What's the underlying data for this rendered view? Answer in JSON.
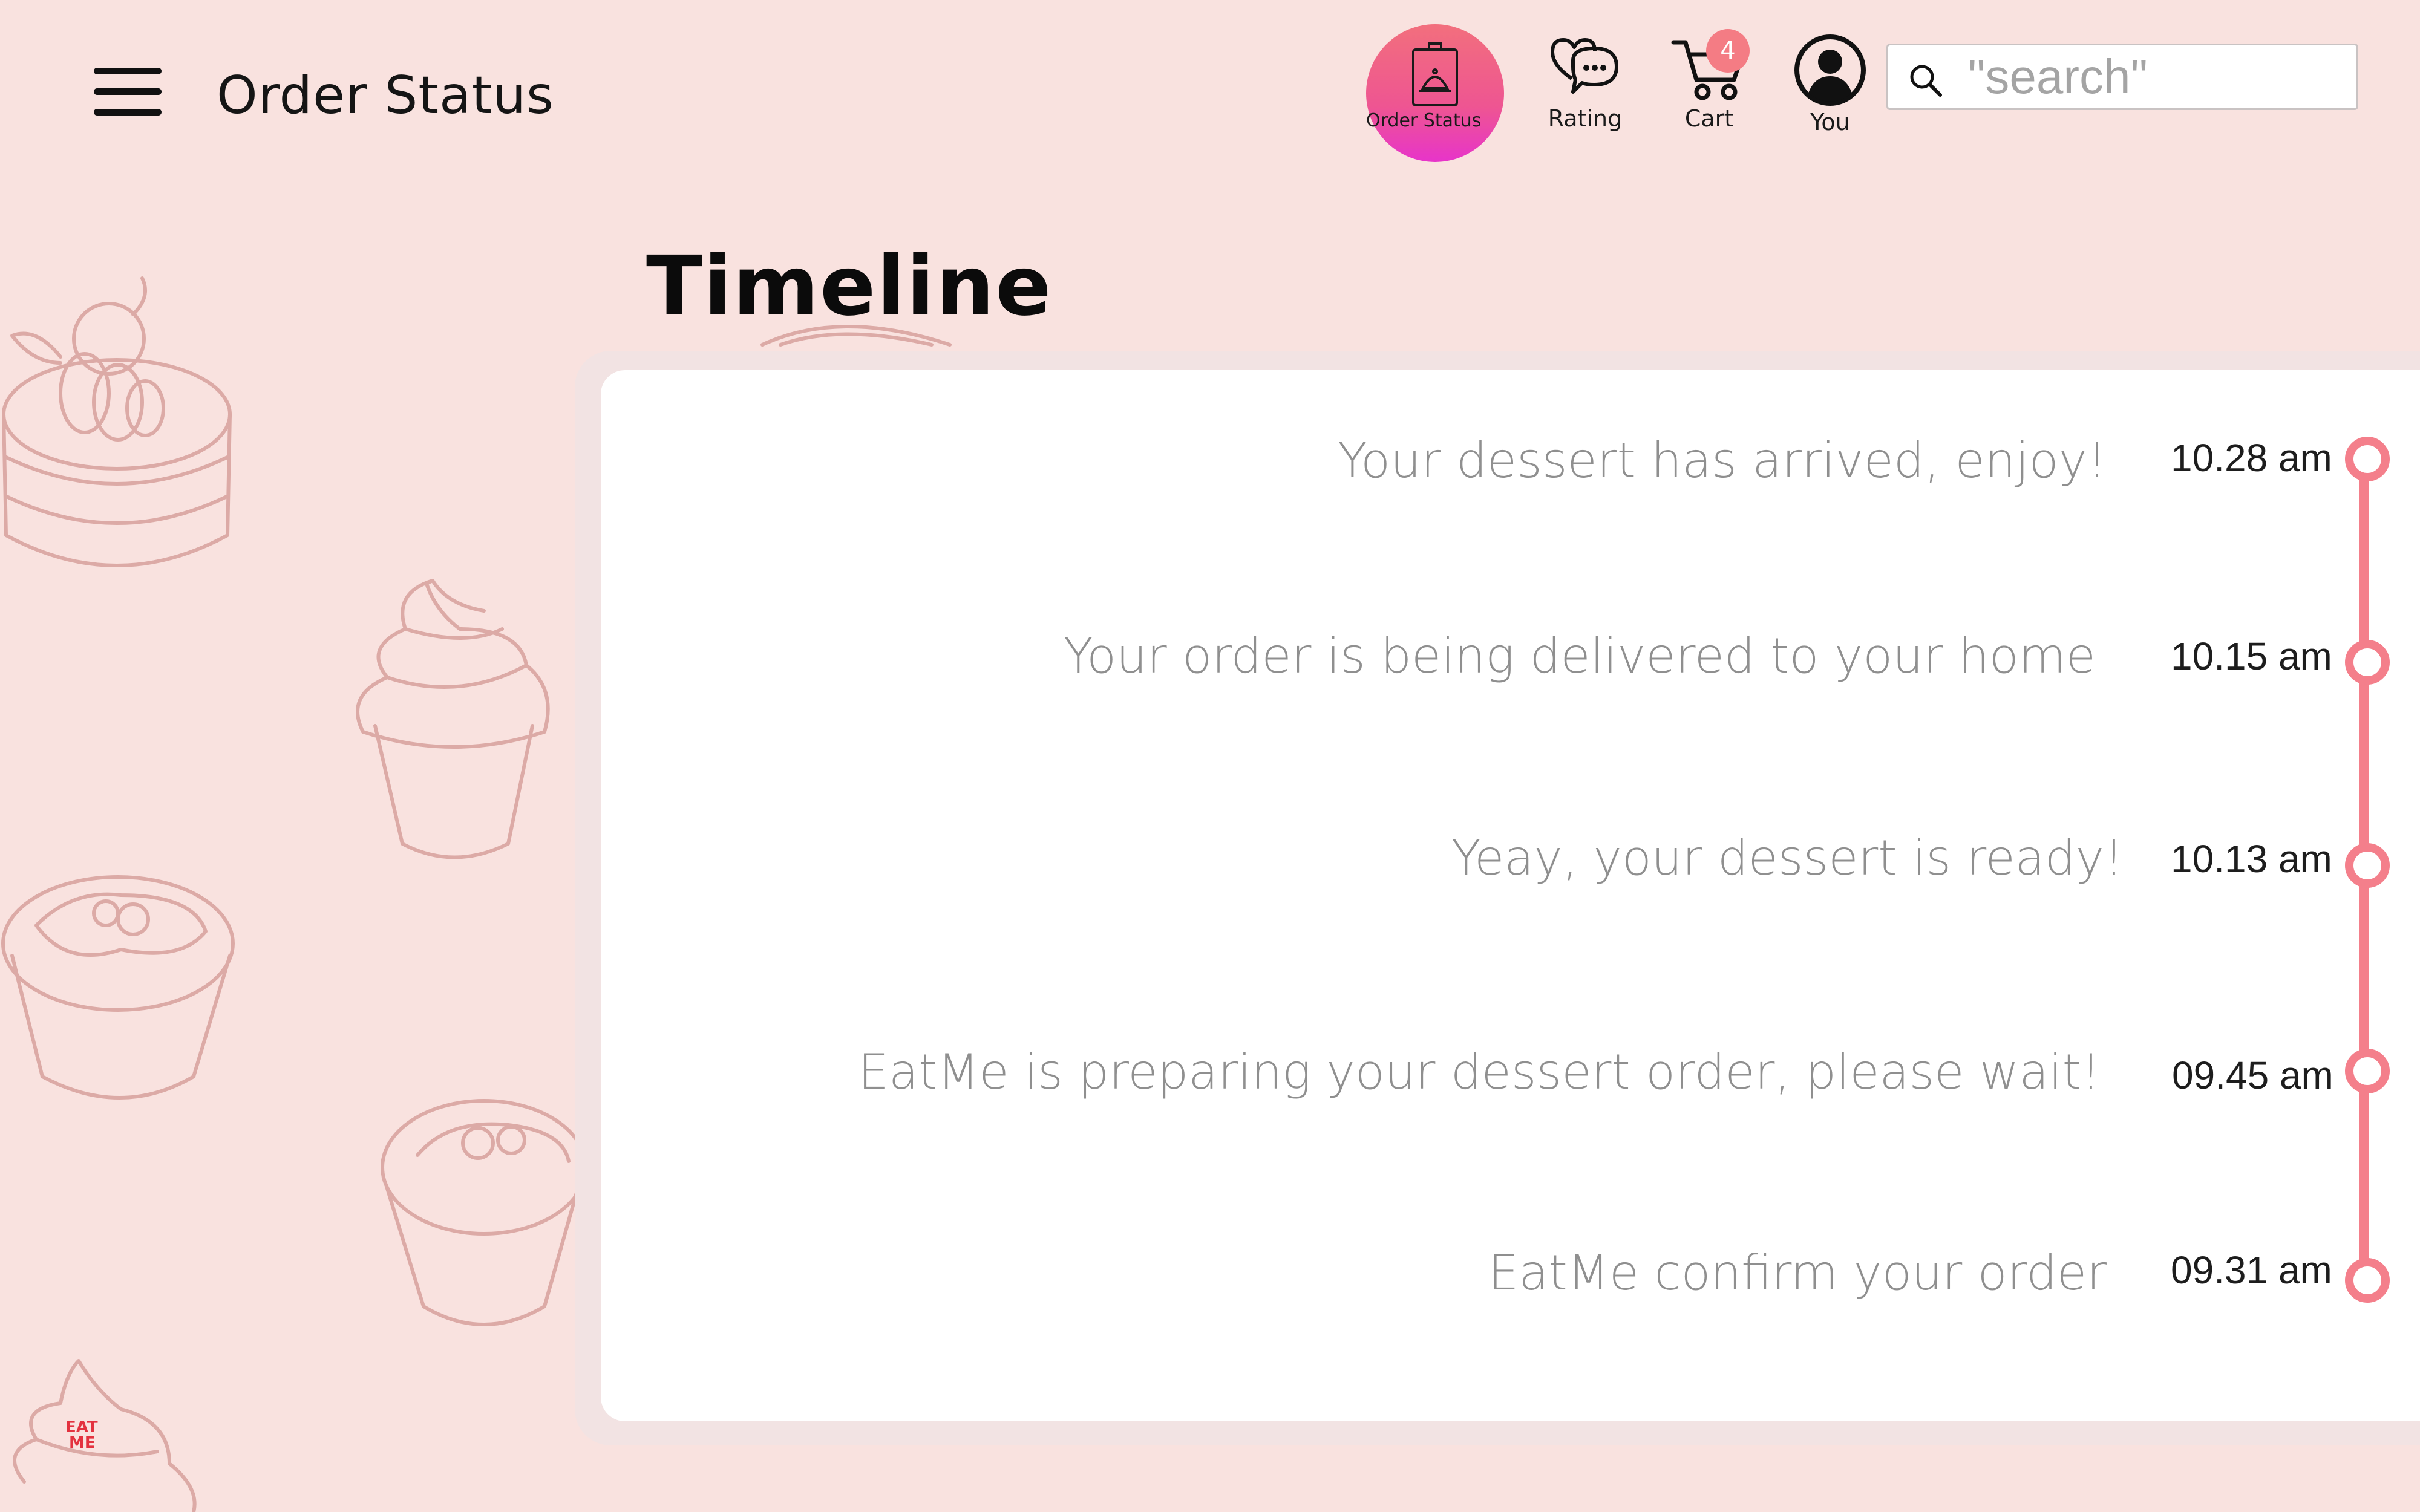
{
  "header": {
    "title": "Order Status",
    "menu_icon": "hamburger-menu-icon",
    "nav": [
      {
        "label": "Order Status",
        "icon": "food-bag-icon",
        "active": true
      },
      {
        "label": "Rating",
        "icon": "heart-chat-icon"
      },
      {
        "label": "Cart",
        "icon": "cart-icon",
        "badge": "4"
      },
      {
        "label": "You",
        "icon": "user-circle-icon"
      }
    ],
    "search": {
      "placeholder": "\"search\"",
      "icon": "search-icon"
    }
  },
  "timeline": {
    "heading": "Timeline",
    "events": [
      {
        "text": "Your dessert has arrived, enjoy!",
        "time": "10.28 am"
      },
      {
        "text": "Your order is being delivered to your home",
        "time": "10.15 am"
      },
      {
        "text": "Yeay, your dessert is ready!",
        "time": "10.13 am"
      },
      {
        "text": "EatMe is preparing your dessert order, please wait!",
        "time": "09.45 am"
      },
      {
        "text": "EatMe confirm your order",
        "time": "09.31 am"
      }
    ]
  },
  "brand": {
    "logo_text": "EAT ME"
  },
  "colors": {
    "background": "#f9e2df",
    "accent": "#f47f8b",
    "active_gradient_top": "#f26f7d",
    "active_gradient_bottom": "#e734ca",
    "card": "#ffffff",
    "event_text": "#8f8f8f",
    "decor_stroke": "#dcaaa6"
  }
}
